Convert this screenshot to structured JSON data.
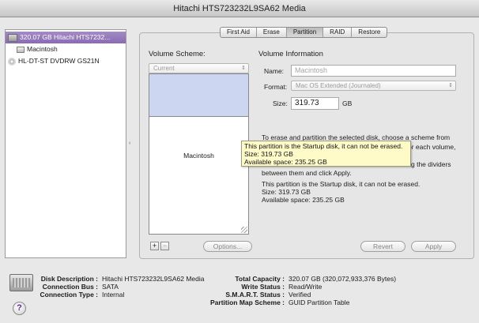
{
  "window": {
    "title": "Hitachi HTS723232L9SA62 Media"
  },
  "sidebar": {
    "items": [
      {
        "label": "320.07 GB Hitachi HTS7232...",
        "icon": "hard-disk-icon",
        "selected": true
      },
      {
        "label": "Macintosh",
        "icon": "volume-icon"
      },
      {
        "label": "HL-DT-ST DVDRW GS21N",
        "icon": "optical-drive-icon"
      }
    ]
  },
  "tabs": [
    "First Aid",
    "Erase",
    "Partition",
    "RAID",
    "Restore"
  ],
  "active_tab": "Partition",
  "partition": {
    "scheme_label": "Volume Scheme:",
    "scheme_value": "Current",
    "info_title": "Volume Information",
    "name_label": "Name:",
    "name_placeholder": "Macintosh",
    "format_label": "Format:",
    "format_value": "Mac OS Extended (Journaled)",
    "size_label": "Size:",
    "size_value": "319.73",
    "size_unit": "GB",
    "partition_name": "Macintosh",
    "desc_lines": [
      "To erase and partition the selected disk, choose a scheme from",
      "or each volume,",
      "g the dividers",
      "between them and click Apply."
    ],
    "startup_lines": [
      "This partition is the Startup disk, it can not be erased.",
      "Size: 319.73 GB",
      "Available space: 235.25 GB"
    ],
    "tooltip_lines": [
      "This partition is the Startup disk, it can not be erased.",
      "Size: 319.73 GB",
      "Available space: 235.25 GB"
    ],
    "add_label": "+",
    "remove_label": "−",
    "options_label": "Options...",
    "revert_label": "Revert",
    "apply_label": "Apply"
  },
  "disk_info": {
    "left": [
      {
        "key": "Disk Description :",
        "value": "Hitachi HTS723232L9SA62 Media"
      },
      {
        "key": "Connection Bus :",
        "value": "SATA"
      },
      {
        "key": "Connection Type :",
        "value": "Internal"
      }
    ],
    "right": [
      {
        "key": "Total Capacity :",
        "value": "320.07 GB (320,072,933,376 Bytes)"
      },
      {
        "key": "Write Status :",
        "value": "Read/Write"
      },
      {
        "key": "S.M.A.R.T. Status :",
        "value": "Verified"
      },
      {
        "key": "Partition Map Scheme :",
        "value": "GUID Partition Table"
      }
    ],
    "help_label": "?"
  }
}
